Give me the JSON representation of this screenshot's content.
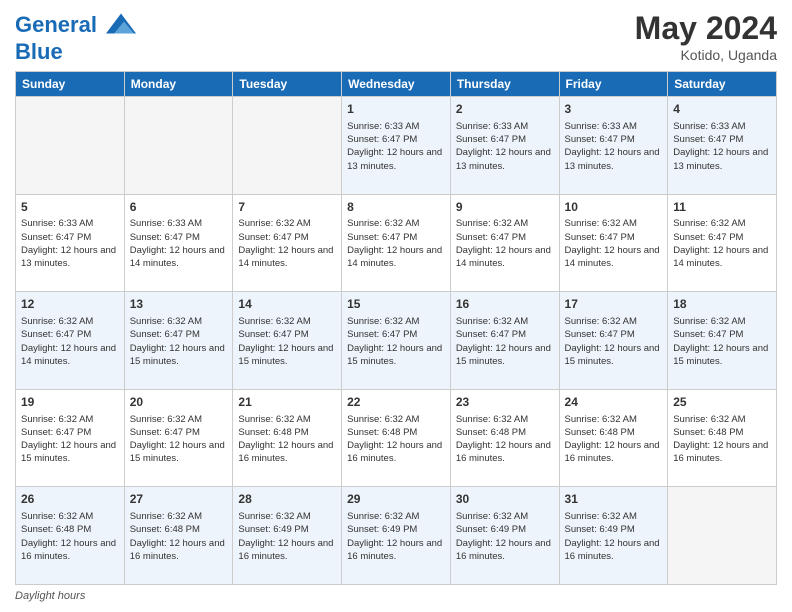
{
  "header": {
    "logo_line1": "General",
    "logo_line2": "Blue",
    "month_year": "May 2024",
    "location": "Kotido, Uganda"
  },
  "footer": {
    "daylight_label": "Daylight hours"
  },
  "days_of_week": [
    "Sunday",
    "Monday",
    "Tuesday",
    "Wednesday",
    "Thursday",
    "Friday",
    "Saturday"
  ],
  "weeks": [
    {
      "days": [
        {
          "num": "",
          "info": ""
        },
        {
          "num": "",
          "info": ""
        },
        {
          "num": "",
          "info": ""
        },
        {
          "num": "1",
          "info": "Sunrise: 6:33 AM\nSunset: 6:47 PM\nDaylight: 12 hours and 13 minutes."
        },
        {
          "num": "2",
          "info": "Sunrise: 6:33 AM\nSunset: 6:47 PM\nDaylight: 12 hours and 13 minutes."
        },
        {
          "num": "3",
          "info": "Sunrise: 6:33 AM\nSunset: 6:47 PM\nDaylight: 12 hours and 13 minutes."
        },
        {
          "num": "4",
          "info": "Sunrise: 6:33 AM\nSunset: 6:47 PM\nDaylight: 12 hours and 13 minutes."
        }
      ]
    },
    {
      "days": [
        {
          "num": "5",
          "info": "Sunrise: 6:33 AM\nSunset: 6:47 PM\nDaylight: 12 hours and 13 minutes."
        },
        {
          "num": "6",
          "info": "Sunrise: 6:33 AM\nSunset: 6:47 PM\nDaylight: 12 hours and 14 minutes."
        },
        {
          "num": "7",
          "info": "Sunrise: 6:32 AM\nSunset: 6:47 PM\nDaylight: 12 hours and 14 minutes."
        },
        {
          "num": "8",
          "info": "Sunrise: 6:32 AM\nSunset: 6:47 PM\nDaylight: 12 hours and 14 minutes."
        },
        {
          "num": "9",
          "info": "Sunrise: 6:32 AM\nSunset: 6:47 PM\nDaylight: 12 hours and 14 minutes."
        },
        {
          "num": "10",
          "info": "Sunrise: 6:32 AM\nSunset: 6:47 PM\nDaylight: 12 hours and 14 minutes."
        },
        {
          "num": "11",
          "info": "Sunrise: 6:32 AM\nSunset: 6:47 PM\nDaylight: 12 hours and 14 minutes."
        }
      ]
    },
    {
      "days": [
        {
          "num": "12",
          "info": "Sunrise: 6:32 AM\nSunset: 6:47 PM\nDaylight: 12 hours and 14 minutes."
        },
        {
          "num": "13",
          "info": "Sunrise: 6:32 AM\nSunset: 6:47 PM\nDaylight: 12 hours and 15 minutes."
        },
        {
          "num": "14",
          "info": "Sunrise: 6:32 AM\nSunset: 6:47 PM\nDaylight: 12 hours and 15 minutes."
        },
        {
          "num": "15",
          "info": "Sunrise: 6:32 AM\nSunset: 6:47 PM\nDaylight: 12 hours and 15 minutes."
        },
        {
          "num": "16",
          "info": "Sunrise: 6:32 AM\nSunset: 6:47 PM\nDaylight: 12 hours and 15 minutes."
        },
        {
          "num": "17",
          "info": "Sunrise: 6:32 AM\nSunset: 6:47 PM\nDaylight: 12 hours and 15 minutes."
        },
        {
          "num": "18",
          "info": "Sunrise: 6:32 AM\nSunset: 6:47 PM\nDaylight: 12 hours and 15 minutes."
        }
      ]
    },
    {
      "days": [
        {
          "num": "19",
          "info": "Sunrise: 6:32 AM\nSunset: 6:47 PM\nDaylight: 12 hours and 15 minutes."
        },
        {
          "num": "20",
          "info": "Sunrise: 6:32 AM\nSunset: 6:47 PM\nDaylight: 12 hours and 15 minutes."
        },
        {
          "num": "21",
          "info": "Sunrise: 6:32 AM\nSunset: 6:48 PM\nDaylight: 12 hours and 16 minutes."
        },
        {
          "num": "22",
          "info": "Sunrise: 6:32 AM\nSunset: 6:48 PM\nDaylight: 12 hours and 16 minutes."
        },
        {
          "num": "23",
          "info": "Sunrise: 6:32 AM\nSunset: 6:48 PM\nDaylight: 12 hours and 16 minutes."
        },
        {
          "num": "24",
          "info": "Sunrise: 6:32 AM\nSunset: 6:48 PM\nDaylight: 12 hours and 16 minutes."
        },
        {
          "num": "25",
          "info": "Sunrise: 6:32 AM\nSunset: 6:48 PM\nDaylight: 12 hours and 16 minutes."
        }
      ]
    },
    {
      "days": [
        {
          "num": "26",
          "info": "Sunrise: 6:32 AM\nSunset: 6:48 PM\nDaylight: 12 hours and 16 minutes."
        },
        {
          "num": "27",
          "info": "Sunrise: 6:32 AM\nSunset: 6:48 PM\nDaylight: 12 hours and 16 minutes."
        },
        {
          "num": "28",
          "info": "Sunrise: 6:32 AM\nSunset: 6:49 PM\nDaylight: 12 hours and 16 minutes."
        },
        {
          "num": "29",
          "info": "Sunrise: 6:32 AM\nSunset: 6:49 PM\nDaylight: 12 hours and 16 minutes."
        },
        {
          "num": "30",
          "info": "Sunrise: 6:32 AM\nSunset: 6:49 PM\nDaylight: 12 hours and 16 minutes."
        },
        {
          "num": "31",
          "info": "Sunrise: 6:32 AM\nSunset: 6:49 PM\nDaylight: 12 hours and 16 minutes."
        },
        {
          "num": "",
          "info": ""
        }
      ]
    }
  ]
}
